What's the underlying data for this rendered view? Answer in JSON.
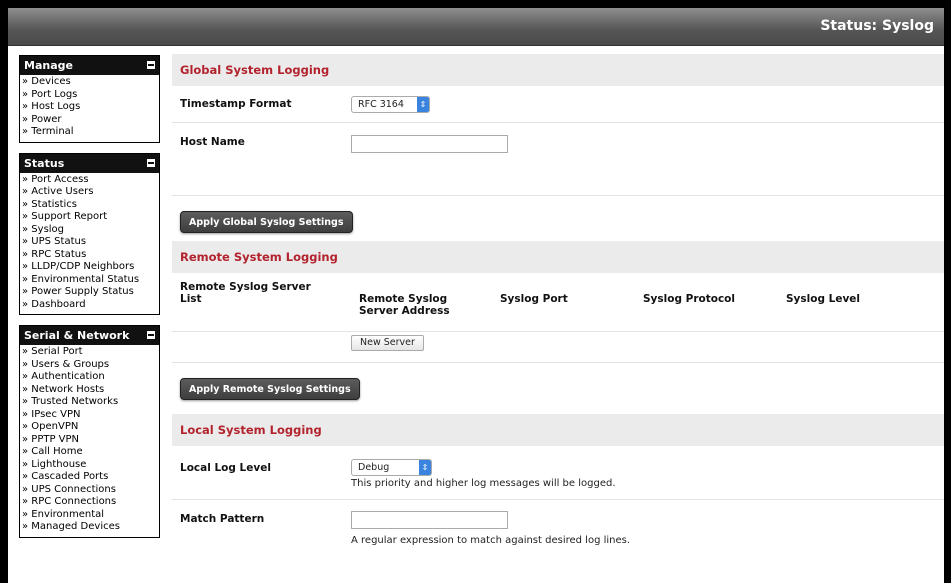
{
  "header": {
    "title": "Status: Syslog"
  },
  "sidebar": {
    "manage": {
      "heading": "Manage",
      "items": [
        "» Devices",
        "» Port Logs",
        "» Host Logs",
        "» Power",
        "» Terminal"
      ]
    },
    "status": {
      "heading": "Status",
      "items": [
        "» Port Access",
        "» Active Users",
        "» Statistics",
        "» Support Report",
        "» Syslog",
        "» UPS Status",
        "» RPC Status",
        "» LLDP/CDP Neighbors",
        "» Environmental Status",
        "» Power Supply Status",
        "» Dashboard"
      ]
    },
    "serial": {
      "heading": "Serial & Network",
      "items": [
        "» Serial Port",
        "» Users & Groups",
        "» Authentication",
        "» Network Hosts",
        "» Trusted Networks",
        "» IPsec VPN",
        "» OpenVPN",
        "» PPTP VPN",
        "» Call Home",
        "» Lighthouse",
        "» Cascaded Ports",
        "» UPS Connections",
        "» RPC Connections",
        "» Environmental",
        "» Managed Devices"
      ]
    }
  },
  "global": {
    "heading": "Global System Logging",
    "timestamp_label": "Timestamp Format",
    "timestamp_value": "RFC 3164",
    "hostname_label": "Host Name",
    "hostname_value": "",
    "apply_label": "Apply Global Syslog Settings"
  },
  "remote": {
    "heading": "Remote System Logging",
    "list_label": "Remote Syslog Server List",
    "columns": [
      "Remote Syslog Server Address",
      "Syslog Port",
      "Syslog Protocol",
      "Syslog Level"
    ],
    "new_server_label": "New Server",
    "apply_label": "Apply Remote Syslog Settings"
  },
  "local": {
    "heading": "Local System Logging",
    "level_label": "Local Log Level",
    "level_value": "Debug",
    "level_hint": "This priority and higher log messages will be logged.",
    "pattern_label": "Match Pattern",
    "pattern_value": "",
    "pattern_hint": "A regular expression to match against desired log lines."
  }
}
